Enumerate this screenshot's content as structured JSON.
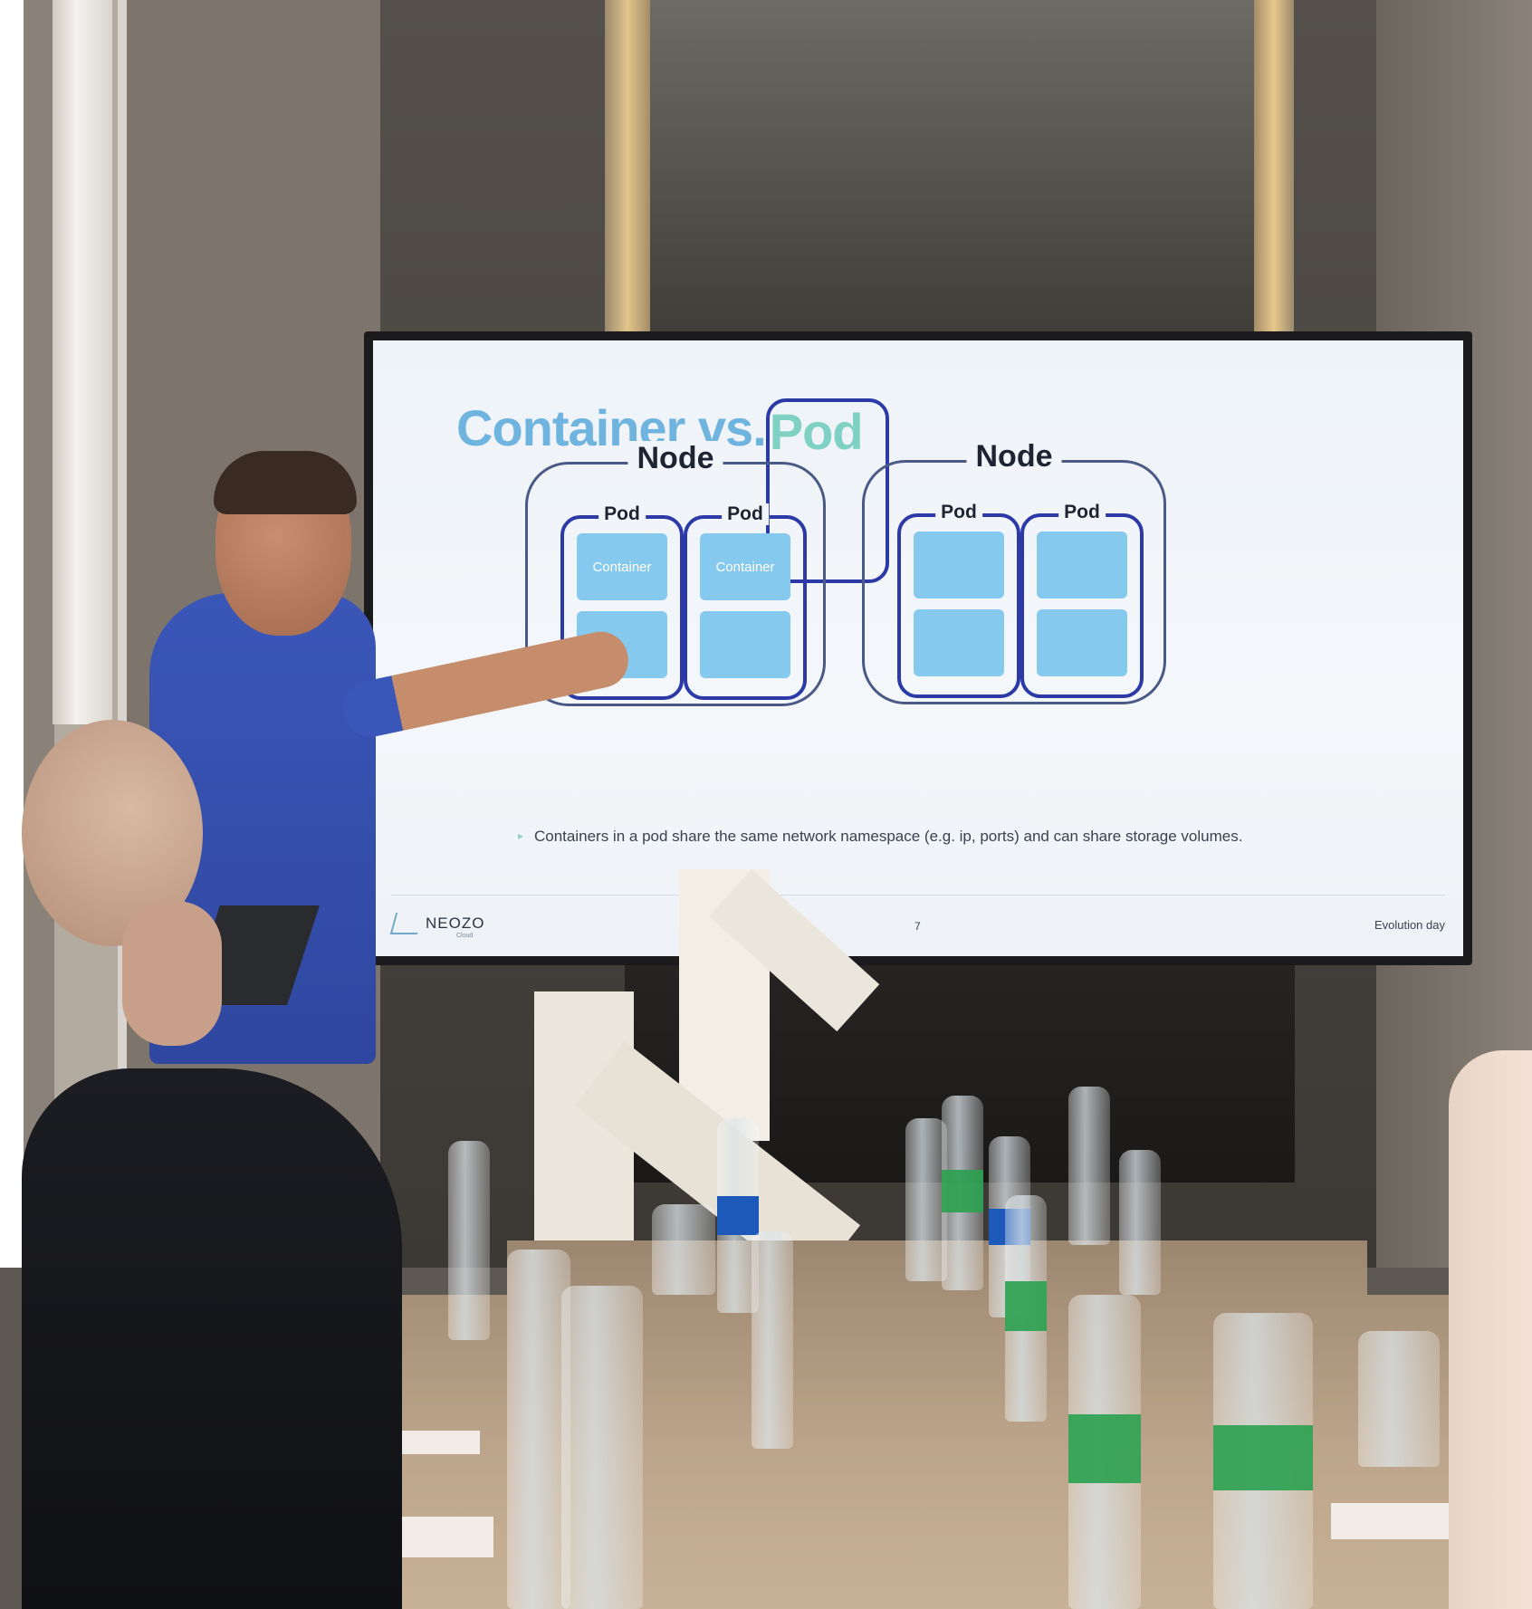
{
  "slide": {
    "title_part1": "Container vs. ",
    "title_part2": "Pod",
    "nodes": [
      {
        "label": "Node",
        "pods": [
          {
            "label": "Pod",
            "containers": [
              "Container",
              ""
            ]
          },
          {
            "label": "Pod",
            "containers": [
              "Container",
              ""
            ]
          }
        ]
      },
      {
        "label": "Node",
        "pods": [
          {
            "label": "Pod",
            "containers": [
              "",
              ""
            ]
          },
          {
            "label": "Pod",
            "containers": [
              "",
              ""
            ]
          }
        ]
      }
    ],
    "bullet": "Containers in a pod share the same network namespace (e.g. ip, ports) and can share storage volumes.",
    "footer": {
      "logo": "NEOZO",
      "logo_sub": "Cloud",
      "page_number": "7",
      "right_text": "Evolution day"
    }
  },
  "colors": {
    "title_blue": "#6fb3df",
    "title_teal": "#7fd1c3",
    "pod_border": "#2b3aa6",
    "container_fill": "#86c9ee",
    "presenter_shirt": "#3a56b8"
  }
}
